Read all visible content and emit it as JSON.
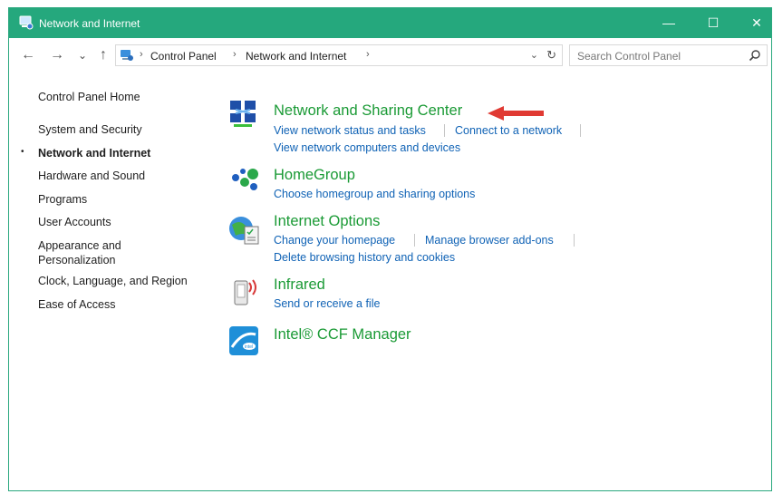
{
  "window": {
    "title": "Network and Internet",
    "controls": {
      "minimize": "—",
      "maximize": "☐",
      "close": "✕"
    }
  },
  "addressbar": {
    "back": "←",
    "forward": "→",
    "recent": "⌄",
    "up": "↑",
    "breadcrumbs": [
      "Control Panel",
      "Network and Internet"
    ],
    "separator": "›",
    "dropdown": "⌄",
    "refresh": "↻",
    "search_placeholder": "Search Control Panel"
  },
  "sidebar": {
    "items": [
      {
        "label": "Control Panel Home",
        "active": false
      },
      {
        "label": "System and Security",
        "active": false
      },
      {
        "label": "Network and Internet",
        "active": true
      },
      {
        "label": "Hardware and Sound",
        "active": false
      },
      {
        "label": "Programs",
        "active": false
      },
      {
        "label": "User Accounts",
        "active": false
      },
      {
        "label": "Appearance and",
        "active": false
      },
      {
        "label": "Personalization",
        "active": false
      },
      {
        "label": "Clock, Language, and Region",
        "active": false
      },
      {
        "label": "Ease of Access",
        "active": false
      }
    ],
    "bullet": "•"
  },
  "categories": [
    {
      "title": "Network and Sharing Center",
      "icon": "network-sharing-icon",
      "links": [
        "View network status and tasks",
        "Connect to a network",
        "View network computers and devices"
      ]
    },
    {
      "title": "HomeGroup",
      "icon": "homegroup-icon",
      "links": [
        "Choose homegroup and sharing options"
      ]
    },
    {
      "title": "Internet Options",
      "icon": "internet-options-icon",
      "links": [
        "Change your homepage",
        "Manage browser add-ons",
        "Delete browsing history and cookies"
      ]
    },
    {
      "title": "Infrared",
      "icon": "infrared-icon",
      "links": [
        "Send or receive a file"
      ]
    },
    {
      "title": "Intel® CCF Manager",
      "icon": "intel-ccf-icon",
      "links": []
    }
  ],
  "colors": {
    "titlebar": "#25a87d",
    "category_title": "#1a9a35",
    "link": "#0f62b5",
    "annotation_arrow": "#e03a33"
  }
}
